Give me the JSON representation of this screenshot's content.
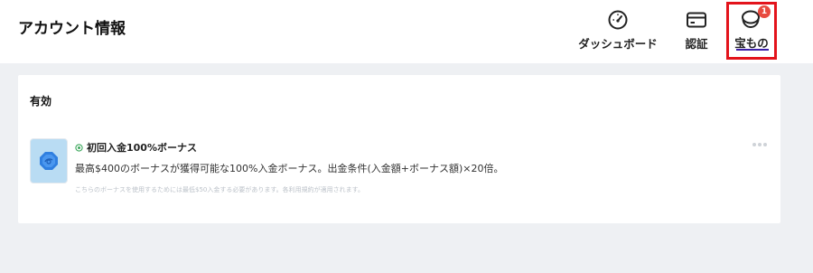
{
  "header": {
    "title": "アカウント情報",
    "nav": [
      {
        "label": "ダッシュボード",
        "icon": "speedometer-icon"
      },
      {
        "label": "認証",
        "icon": "credit-card-icon"
      },
      {
        "label": "宝もの",
        "icon": "treasure-icon",
        "badge": "1",
        "active": true
      }
    ]
  },
  "card": {
    "section_title": "有効",
    "bonus": {
      "thumb_icon": "bonus-coin-icon",
      "status_icon": "active-circle-icon",
      "title": "初回入金100%ボーナス",
      "description": "最高$400のボーナスが獲得可能な100%入金ボーナス。出金条件(入金額+ボーナス額)×20倍。",
      "note": "こちらのボーナスを使用するためには最低$50入金する必要があります。各利用規約が適用されます。",
      "menu_icon": "more-dots-icon"
    }
  },
  "colors": {
    "highlight_border": "#e3131b",
    "active_underline": "#3b1fa8",
    "badge": "#e84a3f",
    "page_background": "#eef0f3"
  }
}
